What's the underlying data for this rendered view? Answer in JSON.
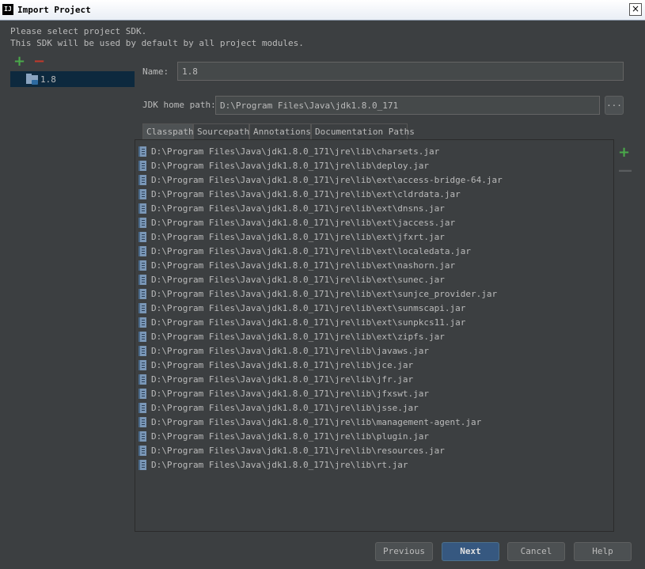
{
  "window": {
    "app_badge": "IJ",
    "title": "Import Project",
    "close_label": "×"
  },
  "description": {
    "line1": "Please select project SDK.",
    "line2": "This SDK will be used by default by all project modules."
  },
  "sdk_toolbar": {
    "add": "+",
    "remove": "−"
  },
  "sdks": [
    {
      "label": "1.8",
      "selected": true
    }
  ],
  "name_field": {
    "label": "Name:",
    "value": "1.8"
  },
  "jdk_home": {
    "label": "JDK home path:",
    "value": "D:\\Program Files\\Java\\jdk1.8.0_171",
    "browse": "..."
  },
  "tabs": [
    {
      "label": "Classpath",
      "active": true
    },
    {
      "label": "Sourcepath",
      "active": false
    },
    {
      "label": "Annotations",
      "active": false
    },
    {
      "label": "Documentation Paths",
      "active": false
    }
  ],
  "classpath": [
    "D:\\Program Files\\Java\\jdk1.8.0_171\\jre\\lib\\charsets.jar",
    "D:\\Program Files\\Java\\jdk1.8.0_171\\jre\\lib\\deploy.jar",
    "D:\\Program Files\\Java\\jdk1.8.0_171\\jre\\lib\\ext\\access-bridge-64.jar",
    "D:\\Program Files\\Java\\jdk1.8.0_171\\jre\\lib\\ext\\cldrdata.jar",
    "D:\\Program Files\\Java\\jdk1.8.0_171\\jre\\lib\\ext\\dnsns.jar",
    "D:\\Program Files\\Java\\jdk1.8.0_171\\jre\\lib\\ext\\jaccess.jar",
    "D:\\Program Files\\Java\\jdk1.8.0_171\\jre\\lib\\ext\\jfxrt.jar",
    "D:\\Program Files\\Java\\jdk1.8.0_171\\jre\\lib\\ext\\localedata.jar",
    "D:\\Program Files\\Java\\jdk1.8.0_171\\jre\\lib\\ext\\nashorn.jar",
    "D:\\Program Files\\Java\\jdk1.8.0_171\\jre\\lib\\ext\\sunec.jar",
    "D:\\Program Files\\Java\\jdk1.8.0_171\\jre\\lib\\ext\\sunjce_provider.jar",
    "D:\\Program Files\\Java\\jdk1.8.0_171\\jre\\lib\\ext\\sunmscapi.jar",
    "D:\\Program Files\\Java\\jdk1.8.0_171\\jre\\lib\\ext\\sunpkcs11.jar",
    "D:\\Program Files\\Java\\jdk1.8.0_171\\jre\\lib\\ext\\zipfs.jar",
    "D:\\Program Files\\Java\\jdk1.8.0_171\\jre\\lib\\javaws.jar",
    "D:\\Program Files\\Java\\jdk1.8.0_171\\jre\\lib\\jce.jar",
    "D:\\Program Files\\Java\\jdk1.8.0_171\\jre\\lib\\jfr.jar",
    "D:\\Program Files\\Java\\jdk1.8.0_171\\jre\\lib\\jfxswt.jar",
    "D:\\Program Files\\Java\\jdk1.8.0_171\\jre\\lib\\jsse.jar",
    "D:\\Program Files\\Java\\jdk1.8.0_171\\jre\\lib\\management-agent.jar",
    "D:\\Program Files\\Java\\jdk1.8.0_171\\jre\\lib\\plugin.jar",
    "D:\\Program Files\\Java\\jdk1.8.0_171\\jre\\lib\\resources.jar",
    "D:\\Program Files\\Java\\jdk1.8.0_171\\jre\\lib\\rt.jar"
  ],
  "path_toolbar": {
    "add": "+",
    "remove": "—"
  },
  "buttons": {
    "previous": "Previous",
    "next": "Next",
    "cancel": "Cancel",
    "help": "Help"
  },
  "colors": {
    "background": "#3c3f41",
    "selection": "#0d293e",
    "primary_button": "#365880",
    "add_icon": "#4aa94a",
    "remove_icon": "#c0392b"
  }
}
